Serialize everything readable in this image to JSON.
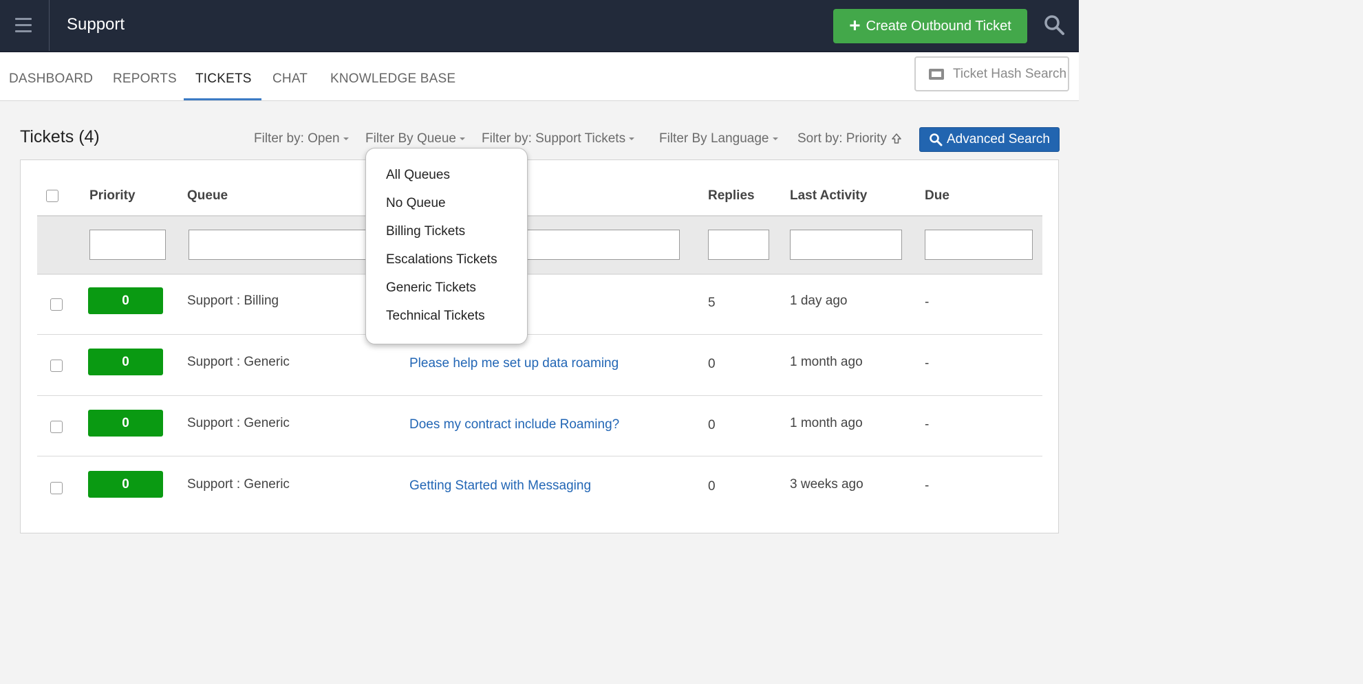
{
  "topbar": {
    "app_title": "Support",
    "create_button_label": "Create Outbound Ticket",
    "icons": {
      "menu": "hamburger-icon",
      "create": "plus-icon",
      "search": "search-icon"
    },
    "create_button_color": "#43a84a"
  },
  "nav": {
    "tabs": [
      {
        "label": "DASHBOARD"
      },
      {
        "label": "REPORTS"
      },
      {
        "label": "TICKETS",
        "active": true
      },
      {
        "label": "CHAT"
      },
      {
        "label": "KNOWLEDGE BASE"
      }
    ],
    "hash_search": {
      "placeholder": "Ticket Hash Search",
      "icon": "ticket-icon"
    }
  },
  "toolbar": {
    "title": "Tickets (4)",
    "filters": [
      {
        "label": "Filter by: Open"
      },
      {
        "label": "Filter By Queue"
      },
      {
        "label": "Filter by: Support Tickets"
      },
      {
        "label": "Filter By Language"
      }
    ],
    "sort_label": "Sort by: Priority",
    "advanced_search_label": "Advanced Search",
    "advanced_search_color": "#2265b0"
  },
  "queue_dropdown": {
    "items": [
      "All Queues",
      "No Queue",
      "Billing Tickets",
      "Escalations Tickets",
      "Generic Tickets",
      "Technical Tickets"
    ]
  },
  "table": {
    "columns": {
      "priority": "Priority",
      "queue": "Queue",
      "replies": "Replies",
      "last_activity": "Last Activity",
      "due": "Due"
    },
    "rows": [
      {
        "priority": "0",
        "queue": "Support : Billing",
        "subject": "",
        "replies": "5",
        "last_activity": "1 day ago",
        "due": "-"
      },
      {
        "priority": "0",
        "queue": "Support : Generic",
        "subject": "Please help me set up data roaming",
        "replies": "0",
        "last_activity": "1 month ago",
        "due": "-"
      },
      {
        "priority": "0",
        "queue": "Support : Generic",
        "subject": "Does my contract include Roaming?",
        "replies": "0",
        "last_activity": "1 month ago",
        "due": "-"
      },
      {
        "priority": "0",
        "queue": "Support : Generic",
        "subject": "Getting Started with Messaging",
        "replies": "0",
        "last_activity": "3 weeks ago",
        "due": "-"
      }
    ],
    "priority_badge_color": "#0a9a12"
  }
}
